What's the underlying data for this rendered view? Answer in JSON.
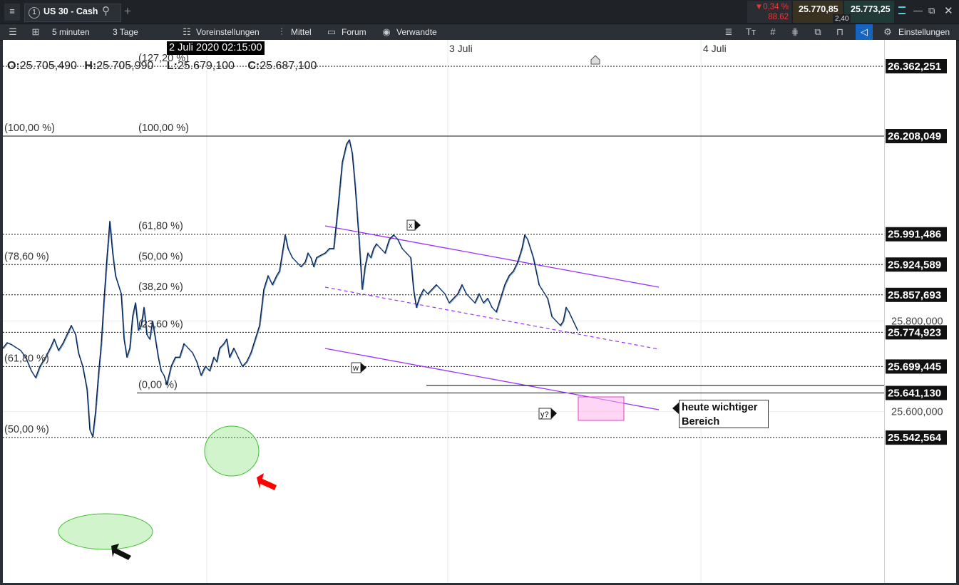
{
  "window": {
    "menu_icon": "hamburger-icon",
    "tab_number": "1",
    "instrument": "US 30 - Cash",
    "search_icon": "search-icon",
    "add_tab": "+",
    "change_pct": "0,34 %",
    "change_abs": "88.62",
    "bid": "25.770,85",
    "ask": "25.773,25",
    "spread": "2,40",
    "accent_red": "#e53935",
    "quote_bg": "#3a3220",
    "controls": [
      "minimize-icon",
      "restore-icon",
      "popout-icon",
      "close-icon"
    ]
  },
  "toolbar": {
    "interval": "5 minuten",
    "range": "3 Tage",
    "presets": "Voreinstellungen",
    "indicator": "Mittel",
    "forum": "Forum",
    "related": "Verwandte",
    "settings": "Einstellungen"
  },
  "chart_data": {
    "type": "line",
    "instrument": "US 30 - Cash",
    "crosshair_date": "2 Juli 2020 02:15:00",
    "ohlc": {
      "O": "25.705,490",
      "H": "25.705,990",
      "L": "25.679,100",
      "C": "25.687,100"
    },
    "x_ticks": [
      "3 Juli",
      "4 Juli"
    ],
    "y_ticks": [
      "25.800,000",
      "25.600,000"
    ],
    "y_range": [
      25480,
      26415
    ],
    "x": [
      0,
      6,
      12,
      18,
      25,
      32,
      40,
      46,
      52,
      60,
      68,
      72,
      78,
      84,
      90,
      96,
      102,
      106,
      112,
      118,
      122,
      126,
      130,
      134,
      138,
      142,
      146,
      150,
      154,
      158,
      162,
      166,
      170,
      174,
      178,
      182,
      186,
      190,
      194,
      198,
      202,
      206,
      210,
      214,
      218,
      222,
      226,
      230,
      236,
      242,
      248,
      254,
      260,
      266,
      272,
      278,
      284,
      290,
      296,
      300,
      304,
      310,
      314,
      318,
      324,
      330,
      336,
      342,
      348,
      354,
      360,
      366,
      372,
      378,
      384,
      388,
      392,
      396,
      400,
      406,
      412,
      418,
      424,
      428,
      432,
      436,
      440,
      446,
      452,
      458,
      464,
      470,
      476,
      482,
      486,
      490,
      494,
      500,
      504,
      508,
      512,
      516,
      520,
      524,
      530,
      536,
      542,
      548,
      554,
      560,
      566,
      572,
      576,
      580,
      584,
      590,
      596,
      602,
      608,
      614,
      620,
      626,
      632,
      638,
      644,
      650,
      656,
      662,
      668,
      674,
      680,
      686,
      692,
      698,
      704,
      710,
      716,
      722,
      728,
      732,
      736,
      740,
      744,
      748,
      752,
      756,
      760,
      764,
      770,
      776,
      782,
      786,
      790,
      794,
      800,
      806,
      812,
      818,
      824,
      828
    ],
    "close": [
      25740,
      25752,
      25748,
      25742,
      25735,
      25720,
      25690,
      25675,
      25700,
      25720,
      25745,
      25760,
      25735,
      25750,
      25770,
      25790,
      25770,
      25730,
      25700,
      25650,
      25560,
      25545,
      25600,
      25680,
      25750,
      25850,
      25940,
      26020,
      25950,
      25900,
      25880,
      25860,
      25760,
      25720,
      25740,
      25810,
      25840,
      25780,
      25790,
      25830,
      25770,
      25760,
      25800,
      25760,
      25720,
      25690,
      25680,
      25660,
      25700,
      25720,
      25720,
      25750,
      25740,
      25730,
      25710,
      25680,
      25700,
      25690,
      25720,
      25710,
      25740,
      25750,
      25760,
      25720,
      25740,
      25720,
      25700,
      25710,
      25730,
      25760,
      25790,
      25870,
      25900,
      25880,
      25900,
      25910,
      25950,
      25990,
      25960,
      25940,
      25930,
      25920,
      25930,
      25950,
      25940,
      25920,
      25940,
      25945,
      25950,
      25960,
      25960,
      26050,
      26150,
      26190,
      26200,
      26170,
      26100,
      25970,
      25870,
      25920,
      25950,
      25940,
      25960,
      25970,
      25960,
      25950,
      25980,
      25990,
      25980,
      25960,
      25950,
      25940,
      25870,
      25830,
      25850,
      25870,
      25860,
      25870,
      25880,
      25870,
      25860,
      25840,
      25850,
      25860,
      25880,
      25860,
      25850,
      25840,
      25860,
      25840,
      25850,
      25830,
      25820,
      25850,
      25880,
      25900,
      25910,
      25930,
      25960,
      25990,
      25980,
      25960,
      25940,
      25910,
      25880,
      25870,
      25860,
      25850,
      25810,
      25800,
      25790,
      25800,
      25830,
      25820,
      25800,
      25780
    ],
    "high": 26208.049,
    "low": 25542.564,
    "price_levels": [
      {
        "label": "26.362,251",
        "value": 26362.251
      },
      {
        "label": "26.208,049",
        "value": 26208.049
      },
      {
        "label": "25.991,486",
        "value": 25991.486
      },
      {
        "label": "25.924,589",
        "value": 25924.589
      },
      {
        "label": "25.857,693",
        "value": 25857.693
      },
      {
        "label": "25.774,923",
        "value": 25774.923
      },
      {
        "label": "25.699,445",
        "value": 25699.445
      },
      {
        "label": "25.641,130",
        "value": 25641.13
      },
      {
        "label": "25.542,564",
        "value": 25542.564
      }
    ],
    "fib_labels": [
      {
        "text": "(127,20 %)",
        "value": 26362.251
      },
      {
        "text": "(100,00 %)",
        "value": 26208.049
      },
      {
        "text": "(100,00 %)",
        "value": 26208.049
      },
      {
        "text": "(61,80 %)",
        "value": 25991.486
      },
      {
        "text": "(78,60 %)",
        "value": 25924.589
      },
      {
        "text": "(50,00 %)",
        "value": 25924.589
      },
      {
        "text": "(38,20 %)",
        "value": 25857.693
      },
      {
        "text": "(23,60 %)",
        "value": 25774.923
      },
      {
        "text": "(61,80 %)",
        "value": 25699.445
      },
      {
        "text": "(0,00 %)",
        "value": 25641.13
      },
      {
        "text": "(50,00 %)",
        "value": 25542.564
      }
    ],
    "wave_labels": [
      "x",
      "w",
      "y?"
    ],
    "annotation": [
      "heute wichtiger",
      "Bereich"
    ],
    "line_color": "#1565c0",
    "channel_color": "#9b30ff",
    "highlight_color": "#ffb3ec",
    "circle_color": "#7ddf6f",
    "arrow_colors": [
      "#ff0000",
      "#000000"
    ]
  }
}
